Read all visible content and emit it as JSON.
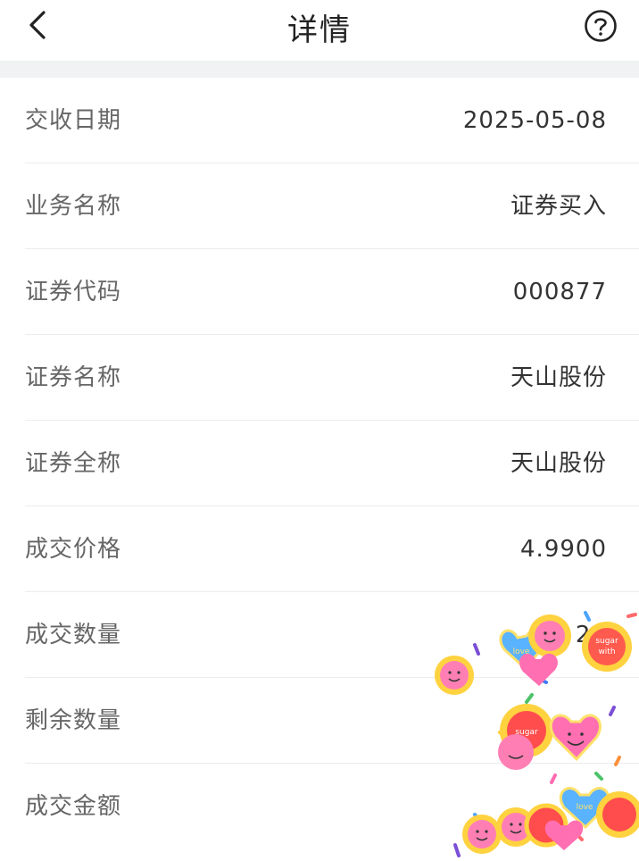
{
  "header": {
    "title": "详情",
    "back_icon": "chevron-left-icon",
    "help_icon": "question-circle-icon"
  },
  "details": [
    {
      "label": "交收日期",
      "value": "2025-05-08"
    },
    {
      "label": "业务名称",
      "value": "证券买入"
    },
    {
      "label": "证券代码",
      "value": "000877"
    },
    {
      "label": "证券名称",
      "value": "天山股份"
    },
    {
      "label": "证券全称",
      "value": "天山股份"
    },
    {
      "label": "成交价格",
      "value": "4.9900"
    },
    {
      "label": "成交数量",
      "value": "20"
    },
    {
      "label": "剩余数量",
      "value": ""
    },
    {
      "label": "成交金额",
      "value": ""
    }
  ],
  "stickers": {
    "text_love": "love",
    "text_sugar": "sugar",
    "text_with": "with"
  },
  "colors": {
    "header_bg": "#ffffff",
    "separator_band": "#f1f2f4",
    "label_text": "#666666",
    "value_text": "#333333",
    "divider": "#ececec"
  }
}
